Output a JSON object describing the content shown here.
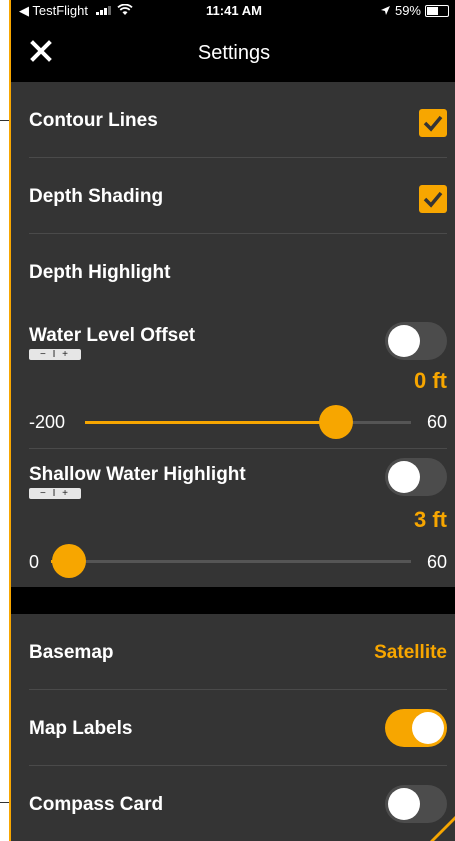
{
  "status_bar": {
    "back_app": "◀ TestFlight",
    "time": "11:41 AM",
    "battery": "59%",
    "battery_level": 0.59
  },
  "nav": {
    "title": "Settings",
    "close_icon": "close-x-icon"
  },
  "settings": {
    "contour_lines": {
      "label": "Contour Lines",
      "checked": true
    },
    "depth_shading": {
      "label": "Depth Shading",
      "checked": true
    },
    "depth_highlight": {
      "label": "Depth Highlight"
    },
    "water_level_offset": {
      "label": "Water Level Offset",
      "badge": "− I +",
      "enabled": false,
      "value_text": "0 ft",
      "min_label": "-200",
      "max_label": "60",
      "min": -200,
      "max": 60,
      "value": 0
    },
    "shallow_water_highlight": {
      "label": "Shallow Water Highlight",
      "badge": "− I +",
      "enabled": false,
      "value_text": "3 ft",
      "min_label": "0",
      "max_label": "60",
      "min": 0,
      "max": 60,
      "value": 3
    },
    "basemap": {
      "label": "Basemap",
      "value": "Satellite"
    },
    "map_labels": {
      "label": "Map Labels",
      "enabled": true
    },
    "compass_card": {
      "label": "Compass Card",
      "enabled": false
    }
  },
  "colors": {
    "accent": "#f7a600",
    "panel": "#343434",
    "background": "#000000"
  }
}
